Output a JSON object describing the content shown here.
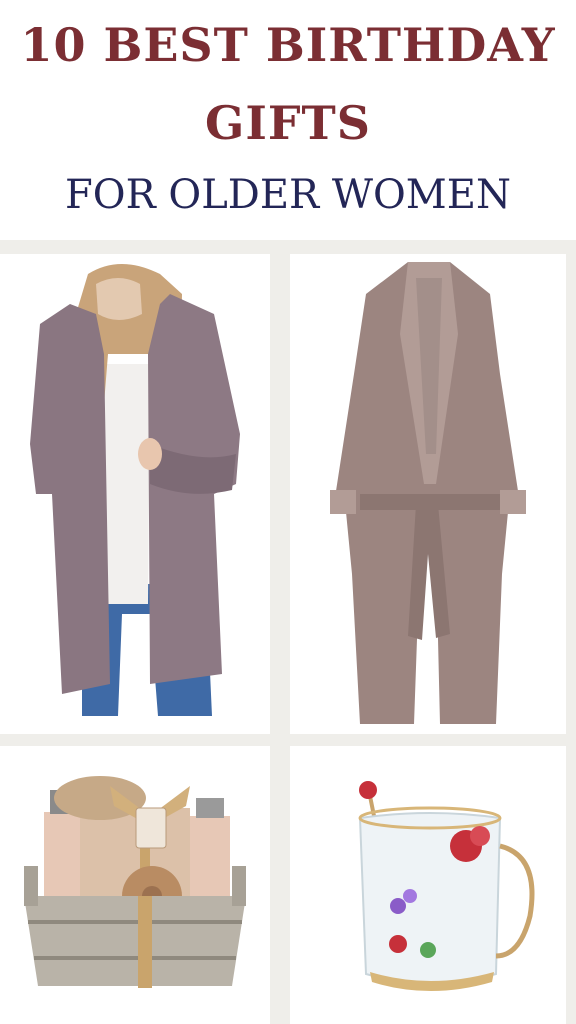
{
  "header": {
    "title_line1": "10 BEST BIRTHDAY",
    "title_line2": "GIFTS",
    "subtitle": "FOR OLDER WOMEN"
  },
  "products": [
    {
      "name": "cardigan",
      "icon": "cardigan-image"
    },
    {
      "name": "robe",
      "icon": "robe-image"
    },
    {
      "name": "spa-basket",
      "icon": "spa-basket-image"
    },
    {
      "name": "glass-mug",
      "icon": "glass-mug-image"
    }
  ],
  "colors": {
    "title": "#7b2e33",
    "subtitle": "#232657",
    "background": "#efeeea"
  }
}
